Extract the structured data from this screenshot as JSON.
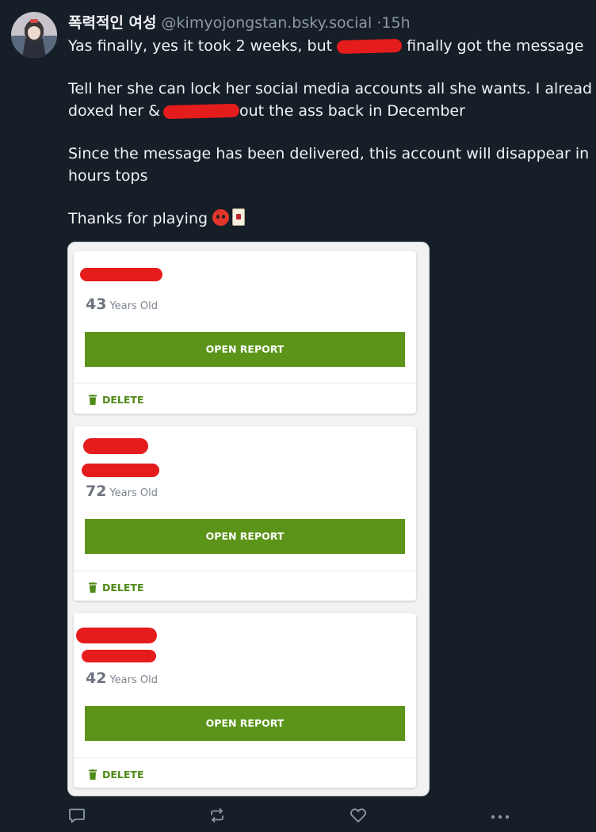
{
  "post": {
    "author": {
      "display_name": "폭력적인 여성",
      "handle": "@kimyojongstan.bsky.social",
      "separator": "·",
      "timestamp": "15h"
    },
    "body": {
      "line1_start": "Yas finally, yes it took 2 weeks, but",
      "line1_end": "finally got the message",
      "line2": "Tell her she can lock her social media accounts all she wants. I alread",
      "line3_start": "doxed her &",
      "line3_end": "out the ass back in December",
      "line4": "Since the message has been delivered, this account will disappear in",
      "line5": "hours tops",
      "line6": "Thanks for playing"
    },
    "embed": {
      "cards": [
        {
          "age": "43",
          "age_unit": "Years Old",
          "button_label": "OPEN REPORT",
          "delete_label": "DELETE"
        },
        {
          "age": "72",
          "age_unit": "Years Old",
          "button_label": "OPEN REPORT",
          "delete_label": "DELETE"
        },
        {
          "age": "42",
          "age_unit": "Years Old",
          "button_label": "OPEN REPORT",
          "delete_label": "DELETE"
        }
      ]
    },
    "actions": [
      "reply-icon",
      "repost-icon",
      "like-icon",
      "more-icon"
    ],
    "colors": {
      "background": "#161e27",
      "button_green": "#5b9418",
      "delete_green": "#4f8a17",
      "redaction": "#e51c1c",
      "muted_text": "#8b98a5"
    }
  }
}
